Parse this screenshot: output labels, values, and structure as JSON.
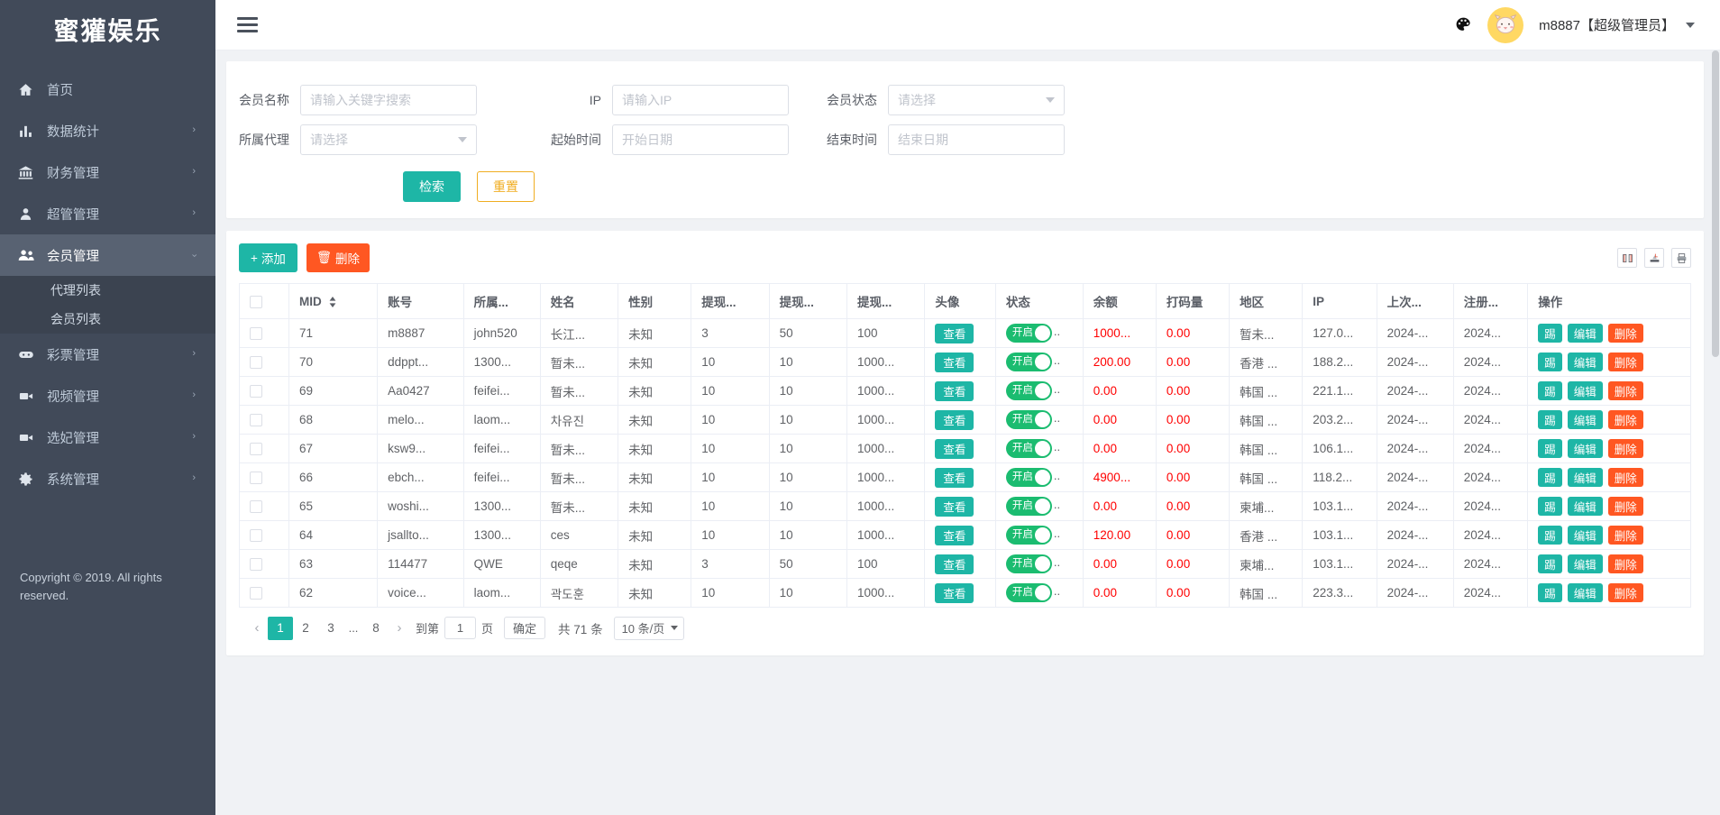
{
  "brand": {
    "title": "蜜獾娱乐"
  },
  "sidebar": {
    "items": [
      {
        "label": "首页",
        "icon": "home-icon",
        "expandable": false
      },
      {
        "label": "数据统计",
        "icon": "chart-bar-icon",
        "expandable": true
      },
      {
        "label": "财务管理",
        "icon": "bank-icon",
        "expandable": true
      },
      {
        "label": "超管管理",
        "icon": "user-icon",
        "expandable": true
      },
      {
        "label": "会员管理",
        "icon": "users-icon",
        "expandable": true,
        "active": true
      },
      {
        "label": "彩票管理",
        "icon": "gamepad-icon",
        "expandable": true
      },
      {
        "label": "视频管理",
        "icon": "video-camera-icon",
        "expandable": true
      },
      {
        "label": "选妃管理",
        "icon": "video-icon",
        "expandable": true
      },
      {
        "label": "系统管理",
        "icon": "gear-icon",
        "expandable": true
      }
    ],
    "submenu": [
      {
        "label": "代理列表"
      },
      {
        "label": "会员列表"
      }
    ],
    "copyright": "Copyright © 2019. All rights reserved."
  },
  "topbar": {
    "menu_toggle": "hamburger-icon",
    "theme_icon": "palette-icon",
    "avatar_icon": "cat-avatar",
    "user": "m8887【超级管理员】"
  },
  "search": {
    "fields": [
      {
        "label": "会员名称",
        "placeholder": "请输入关键字搜索",
        "type": "input",
        "value": ""
      },
      {
        "label": "IP",
        "placeholder": "请输入IP",
        "type": "input",
        "value": ""
      },
      {
        "label": "会员状态",
        "placeholder": "请选择",
        "type": "select",
        "value": ""
      },
      {
        "label": "所属代理",
        "placeholder": "请选择",
        "type": "select",
        "value": ""
      },
      {
        "label": "起始时间",
        "placeholder": "开始日期",
        "type": "date",
        "value": ""
      },
      {
        "label": "结束时间",
        "placeholder": "结束日期",
        "type": "date",
        "value": ""
      }
    ],
    "submit_label": "检索",
    "reset_label": "重置"
  },
  "toolbar": {
    "add_label": "添加",
    "delete_label": "删除",
    "icons": [
      "columns-icon",
      "export-icon",
      "print-icon"
    ]
  },
  "table": {
    "columns": [
      {
        "key": "check",
        "label": ""
      },
      {
        "key": "mid",
        "label": "MID",
        "sortable": true
      },
      {
        "key": "account",
        "label": "账号"
      },
      {
        "key": "belong",
        "label": "所属..."
      },
      {
        "key": "name",
        "label": "姓名"
      },
      {
        "key": "gender",
        "label": "性别"
      },
      {
        "key": "wd1",
        "label": "提现..."
      },
      {
        "key": "wd2",
        "label": "提现..."
      },
      {
        "key": "wd3",
        "label": "提现..."
      },
      {
        "key": "avatar",
        "label": "头像"
      },
      {
        "key": "status",
        "label": "状态"
      },
      {
        "key": "balance",
        "label": "余额"
      },
      {
        "key": "bet",
        "label": "打码量"
      },
      {
        "key": "region",
        "label": "地区"
      },
      {
        "key": "ip",
        "label": "IP"
      },
      {
        "key": "lastlogin",
        "label": "上次..."
      },
      {
        "key": "register",
        "label": "注册..."
      },
      {
        "key": "actions",
        "label": "操作"
      }
    ],
    "view_label": "查看",
    "switch_on_label": "开启",
    "switch_suffix": "..",
    "action_labels": {
      "kick": "踢",
      "edit": "编辑",
      "delete": "删除"
    },
    "rows": [
      {
        "mid": "71",
        "account": "m8887",
        "belong": "john520",
        "name": "长江...",
        "gender": "未知",
        "wd1": "3",
        "wd2": "50",
        "wd3": "100",
        "balance": "1000...",
        "bet": "0.00",
        "region": "暂未...",
        "ip": "127.0...",
        "lastlogin": "2024-...",
        "register": "2024..."
      },
      {
        "mid": "70",
        "account": "ddppt...",
        "belong": "1300...",
        "name": "暂未...",
        "gender": "未知",
        "wd1": "10",
        "wd2": "10",
        "wd3": "1000...",
        "balance": "200.00",
        "bet": "0.00",
        "region": "香港 ...",
        "ip": "188.2...",
        "lastlogin": "2024-...",
        "register": "2024..."
      },
      {
        "mid": "69",
        "account": "Aa0427",
        "belong": "feifei...",
        "name": "暂未...",
        "gender": "未知",
        "wd1": "10",
        "wd2": "10",
        "wd3": "1000...",
        "balance": "0.00",
        "bet": "0.00",
        "region": "韩国 ...",
        "ip": "221.1...",
        "lastlogin": "2024-...",
        "register": "2024..."
      },
      {
        "mid": "68",
        "account": "melo...",
        "belong": "laom...",
        "name": "차유진",
        "gender": "未知",
        "wd1": "10",
        "wd2": "10",
        "wd3": "1000...",
        "balance": "0.00",
        "bet": "0.00",
        "region": "韩国 ...",
        "ip": "203.2...",
        "lastlogin": "2024-...",
        "register": "2024..."
      },
      {
        "mid": "67",
        "account": "ksw9...",
        "belong": "feifei...",
        "name": "暂未...",
        "gender": "未知",
        "wd1": "10",
        "wd2": "10",
        "wd3": "1000...",
        "balance": "0.00",
        "bet": "0.00",
        "region": "韩国 ...",
        "ip": "106.1...",
        "lastlogin": "2024-...",
        "register": "2024..."
      },
      {
        "mid": "66",
        "account": "ebch...",
        "belong": "feifei...",
        "name": "暂未...",
        "gender": "未知",
        "wd1": "10",
        "wd2": "10",
        "wd3": "1000...",
        "balance": "4900...",
        "bet": "0.00",
        "region": "韩国 ...",
        "ip": "118.2...",
        "lastlogin": "2024-...",
        "register": "2024..."
      },
      {
        "mid": "65",
        "account": "woshi...",
        "belong": "1300...",
        "name": "暂未...",
        "gender": "未知",
        "wd1": "10",
        "wd2": "10",
        "wd3": "1000...",
        "balance": "0.00",
        "bet": "0.00",
        "region": "柬埔...",
        "ip": "103.1...",
        "lastlogin": "2024-...",
        "register": "2024..."
      },
      {
        "mid": "64",
        "account": "jsallto...",
        "belong": "1300...",
        "name": "ces",
        "gender": "未知",
        "wd1": "10",
        "wd2": "10",
        "wd3": "1000...",
        "balance": "120.00",
        "bet": "0.00",
        "region": "香港 ...",
        "ip": "103.1...",
        "lastlogin": "2024-...",
        "register": "2024..."
      },
      {
        "mid": "63",
        "account": "114477",
        "belong": "QWE",
        "name": "qeqe",
        "gender": "未知",
        "wd1": "3",
        "wd2": "50",
        "wd3": "100",
        "balance": "0.00",
        "bet": "0.00",
        "region": "柬埔...",
        "ip": "103.1...",
        "lastlogin": "2024-...",
        "register": "2024..."
      },
      {
        "mid": "62",
        "account": "voice...",
        "belong": "laom...",
        "name": "곽도훈",
        "gender": "未知",
        "wd1": "10",
        "wd2": "10",
        "wd3": "1000...",
        "balance": "0.00",
        "bet": "0.00",
        "region": "韩国 ...",
        "ip": "223.3...",
        "lastlogin": "2024-...",
        "register": "2024..."
      }
    ]
  },
  "pagination": {
    "prev": "‹",
    "next": "›",
    "pages": [
      "1",
      "2",
      "3"
    ],
    "ellipsis": "...",
    "last_page": "8",
    "current": "1",
    "goto_prefix": "到第",
    "goto_value": "1",
    "goto_suffix": "页",
    "confirm_label": "确定",
    "total_label": "共 71 条",
    "page_size_label": "10 条/页"
  },
  "colors": {
    "sidebar_bg": "#414a59",
    "primary_teal": "#1eb6a6",
    "danger_orange": "#ff5722",
    "warning_orange": "#f0ad21",
    "switch_green": "#1bbc70",
    "amount_red": "#ff0000",
    "avatar_yellow": "#ffd863"
  }
}
